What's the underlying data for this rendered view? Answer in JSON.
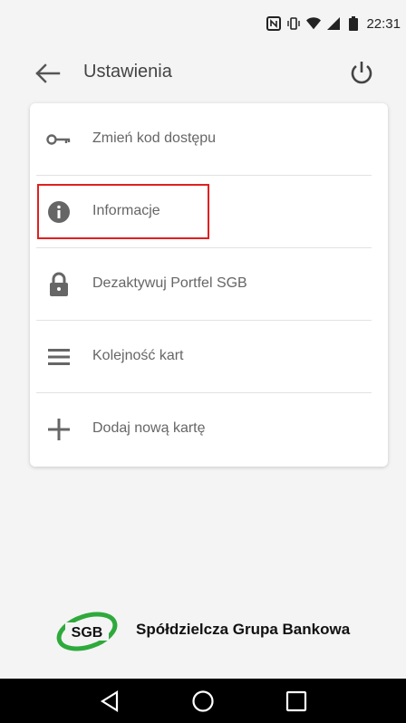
{
  "status_bar": {
    "time": "22:31",
    "icons": [
      "nfc-icon",
      "vibrate-icon",
      "wifi-icon",
      "signal-icon",
      "battery-icon"
    ]
  },
  "app_bar": {
    "title": "Ustawienia",
    "back_icon": "arrow-left-icon",
    "power_icon": "power-icon"
  },
  "menu": {
    "items": [
      {
        "label": "Zmień kod dostępu",
        "icon": "key-icon"
      },
      {
        "label": "Informacje",
        "icon": "info-icon"
      },
      {
        "label": "Dezaktywuj Portfel SGB",
        "icon": "lock-icon"
      },
      {
        "label": "Kolejność kart",
        "icon": "menu-lines-icon"
      },
      {
        "label": "Dodaj nową kartę",
        "icon": "plus-icon"
      }
    ],
    "highlight_color": "#e02020"
  },
  "brand": {
    "logo_text": "SGB",
    "name": "Spółdzielcza Grupa Bankowa",
    "logo_color": "#2eaa3c"
  },
  "nav_bar": {
    "buttons": [
      "back-triangle-icon",
      "home-circle-icon",
      "recents-square-icon"
    ]
  }
}
